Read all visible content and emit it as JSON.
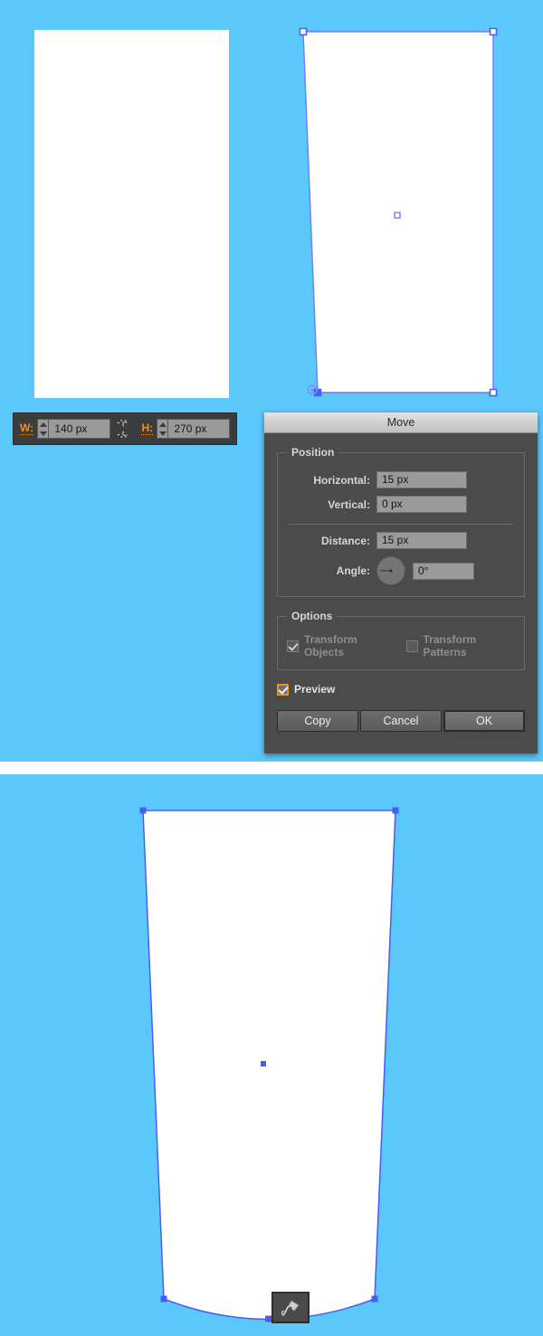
{
  "app": "Adobe Illustrator",
  "canvas": {
    "background_color": "#5bc8fc",
    "selection_color": "#4b5bfa",
    "shape_fill": "#ffffff"
  },
  "top_panel": {
    "shapes": [
      {
        "name": "plain-rectangle",
        "description": "Unselected white rectangle",
        "selected": false
      },
      {
        "name": "tapered-rectangle",
        "description": "White rectangle with left edge skewed inward, selected with anchor points",
        "selected": true
      }
    ],
    "anchor_points": [
      {
        "name": "top-left",
        "state": "hollow"
      },
      {
        "name": "top-right",
        "state": "hollow"
      },
      {
        "name": "bottom-left",
        "state": "filled"
      },
      {
        "name": "bottom-right",
        "state": "hollow"
      },
      {
        "name": "center",
        "state": "center-point"
      }
    ],
    "cursor": "move-crosshair"
  },
  "transform_bar": {
    "width_label": "W:",
    "width_value": "140 px",
    "height_label": "H:",
    "height_value": "270 px",
    "link_icon": "broken-chain-link-icon",
    "link_state": "unlinked",
    "accent_color": "#e8902a"
  },
  "move_dialog": {
    "title": "Move",
    "position_group": {
      "legend": "Position",
      "fields": [
        {
          "label": "Horizontal:",
          "value": "15 px",
          "name": "horizontal-field"
        },
        {
          "label": "Vertical:",
          "value": "0 px",
          "name": "vertical-field"
        },
        {
          "label": "Distance:",
          "value": "15 px",
          "name": "distance-field"
        },
        {
          "label": "Angle:",
          "value": "0°",
          "name": "angle-field"
        }
      ]
    },
    "options_group": {
      "legend": "Options",
      "transform_objects": {
        "label": "Transform Objects",
        "checked": true,
        "enabled": false
      },
      "transform_patterns": {
        "label": "Transform Patterns",
        "checked": false,
        "enabled": false
      }
    },
    "preview": {
      "label": "Preview",
      "checked": true
    },
    "buttons": {
      "copy": "Copy",
      "cancel": "Cancel",
      "ok": "OK"
    }
  },
  "bottom_panel": {
    "shape": {
      "name": "cup-shape",
      "description": "Tapered cup silhouette with curved bottom edge",
      "selected": true
    },
    "anchor_points": [
      {
        "name": "top-left",
        "state": "filled"
      },
      {
        "name": "top-right",
        "state": "filled"
      },
      {
        "name": "bottom-left",
        "state": "filled"
      },
      {
        "name": "bottom-right",
        "state": "filled"
      },
      {
        "name": "bottom-center",
        "state": "filled"
      },
      {
        "name": "center",
        "state": "center-point"
      }
    ],
    "tool_badge": "pen-tool-icon"
  }
}
